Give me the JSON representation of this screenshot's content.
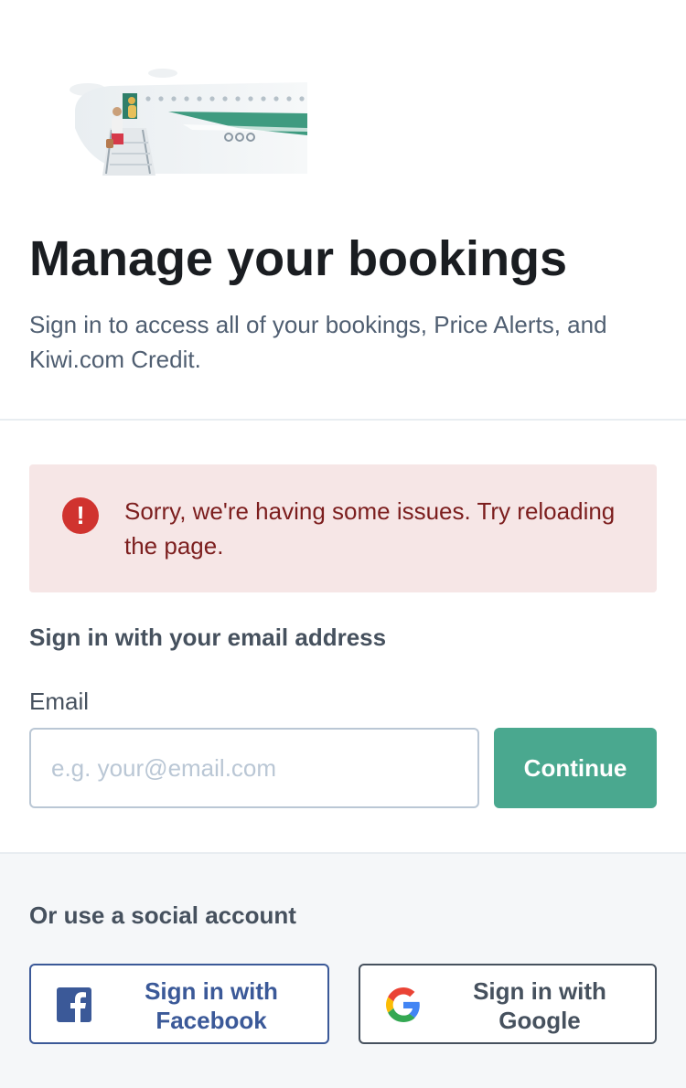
{
  "header": {
    "title": "Manage your bookings",
    "subtitle": "Sign in to access all of your bookings, Price Alerts, and Kiwi.com Credit."
  },
  "alert": {
    "icon": "exclamation-circle-icon",
    "symbol": "!",
    "message": "Sorry, we're having some issues. Try reloading the page."
  },
  "email_section": {
    "heading": "Sign in with your email address",
    "label": "Email",
    "input_value": "",
    "placeholder": "e.g. your@email.com",
    "continue_label": "Continue"
  },
  "social": {
    "heading": "Or use a social account",
    "facebook_label": "Sign in with Facebook",
    "google_label": "Sign in with Google"
  },
  "colors": {
    "accent": "#4aa88f",
    "alert_bg": "#f6e6e6",
    "alert_icon": "#d0332f",
    "facebook": "#3b5998"
  }
}
